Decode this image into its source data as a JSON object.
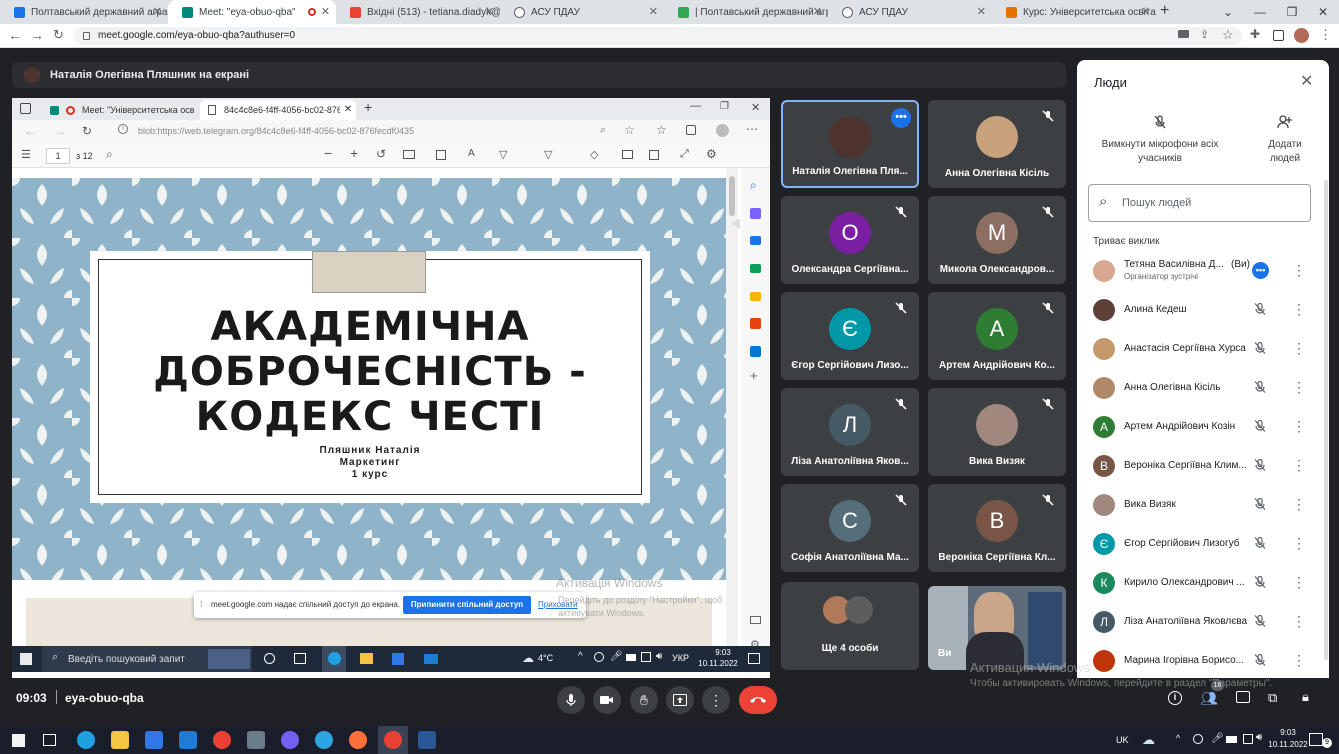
{
  "browser": {
    "tabs": [
      {
        "title": "Полтавський державний аграр",
        "color": "#1a73e8"
      },
      {
        "title": "Meet: \"eya-obuo-qba\"",
        "color": "#00897b"
      },
      {
        "title": "Вхідні (513) - tetiana.diadyk@p",
        "color": "#ea4335"
      },
      {
        "title": "АСУ ПДАУ",
        "color": "#5f6368"
      },
      {
        "title": "| Полтавський державний агра",
        "color": "#34a853"
      },
      {
        "title": "АСУ ПДАУ",
        "color": "#5f6368"
      },
      {
        "title": "Курс: Університетська освіта_н",
        "color": "#e37400"
      }
    ],
    "url": "meet.google.com/eya-obuo-qba?authuser=0"
  },
  "meet": {
    "presenting_label": "Наталія Олегівна Пляшник на екрані",
    "time": "09:03",
    "code": "eya-obuo-qba",
    "participant_badge": "16"
  },
  "shared": {
    "tabs": [
      {
        "title": "Meet: \"Університетська осв"
      },
      {
        "title": "84c4c8e6-f4ff-4056-bc02-876fe"
      }
    ],
    "url": "blob:https://web.telegram.org/84c4c8e6-f4ff-4056-bc02-876fecdf0435",
    "page_num": "1",
    "page_total": "з 12",
    "slide": {
      "title_lines": [
        "АКАДЕМІЧНА",
        "ДОБРОЧЕСНІСТЬ -",
        "КОДЕКС ЧЕСТІ"
      ],
      "author": "Пляшник Наталія",
      "subject": "Маркетинг",
      "course": "1 курс"
    },
    "share_notice": "meet.google.com надає спільний доступ до екрана.",
    "stop_button": "Припинити спільний доступ",
    "hide_link": "Приховати",
    "watermark_title": "Активація Windows",
    "watermark_sub": "Перейдіть до розділу \"Настройки\", щоб активувати Windows.",
    "search_placeholder": "Введіть пошуковий запит",
    "temperature": "4°C",
    "lang": "УКР",
    "clock_time": "9:03",
    "clock_date": "10.11.2022"
  },
  "tiles": [
    {
      "name": "Наталія Олегівна Пля...",
      "letter": "",
      "color": "#6d4c41",
      "photo": true
    },
    {
      "name": "Анна Олегівна Кісіль",
      "letter": "",
      "color": "#c8a27a",
      "photo": true
    },
    {
      "name": "Олександра Сергіївна...",
      "letter": "О",
      "color": "#7b1fa2"
    },
    {
      "name": "Микола Олександров...",
      "letter": "М",
      "color": "#8d6e63"
    },
    {
      "name": "Єгор Сергійович Лизо...",
      "letter": "Є",
      "color": "#0097a7"
    },
    {
      "name": "Артем Андрійович Ко...",
      "letter": "А",
      "color": "#2e7d32"
    },
    {
      "name": "Ліза Анатоліївна Яков...",
      "letter": "Л",
      "color": "#455a64"
    },
    {
      "name": "Вика Визяк",
      "letter": "",
      "color": "#a1887f",
      "photo": true
    },
    {
      "name": "Софія Анатоліївна Ма...",
      "letter": "С",
      "color": "#546e7a"
    },
    {
      "name": "Вероніка Сергіївна Кл...",
      "letter": "В",
      "color": "#795548"
    },
    {
      "name": "Ще 4 особи",
      "letter": "",
      "color": "#3c4043"
    },
    {
      "name": "Ви",
      "letter": "",
      "color": "#5d6b7a"
    }
  ],
  "people": {
    "title": "Люди",
    "mute_all": "Вимкнути мікрофони всіх учасників",
    "add": "Додати людей",
    "search_placeholder": "Пошук людей",
    "section": "Триває виклик",
    "self_name": "Тетяна Василівна Д...",
    "self_tag": "(Ви)",
    "self_role": "Організатор зустрічі",
    "list": [
      {
        "name": "Алина Кедеш",
        "color": "#5d4037",
        "letter": ""
      },
      {
        "name": "Анастасія Сергіївна Хурса",
        "color": "#c49a6c",
        "letter": ""
      },
      {
        "name": "Анна Олегівна Кісіль",
        "color": "#b08968",
        "letter": ""
      },
      {
        "name": "Артем Андрійович Козін",
        "color": "#2e7d32",
        "letter": "А"
      },
      {
        "name": "Вероніка Сергіївна Клим...",
        "color": "#795548",
        "letter": "В"
      },
      {
        "name": "Вика Визяк",
        "color": "#a1887f",
        "letter": ""
      },
      {
        "name": "Єгор Сергійович Лизогуб",
        "color": "#0097a7",
        "letter": "Є"
      },
      {
        "name": "Кирило Олександрович ...",
        "color": "#1b8a5a",
        "letter": "К"
      },
      {
        "name": "Ліза Анатоліївна Яковлєва",
        "color": "#455a64",
        "letter": "Л"
      },
      {
        "name": "Марина Ігорівна Борисо...",
        "color": "#bf360c",
        "letter": ""
      }
    ]
  },
  "outer_watermark": {
    "title": "Активация Windows",
    "sub": "Чтобы активировать Windows, перейдите в раздел \"Параметры\"."
  },
  "taskbar": {
    "lang": "UK",
    "time": "9:03",
    "date": "10.11.2022",
    "notif": "9"
  }
}
